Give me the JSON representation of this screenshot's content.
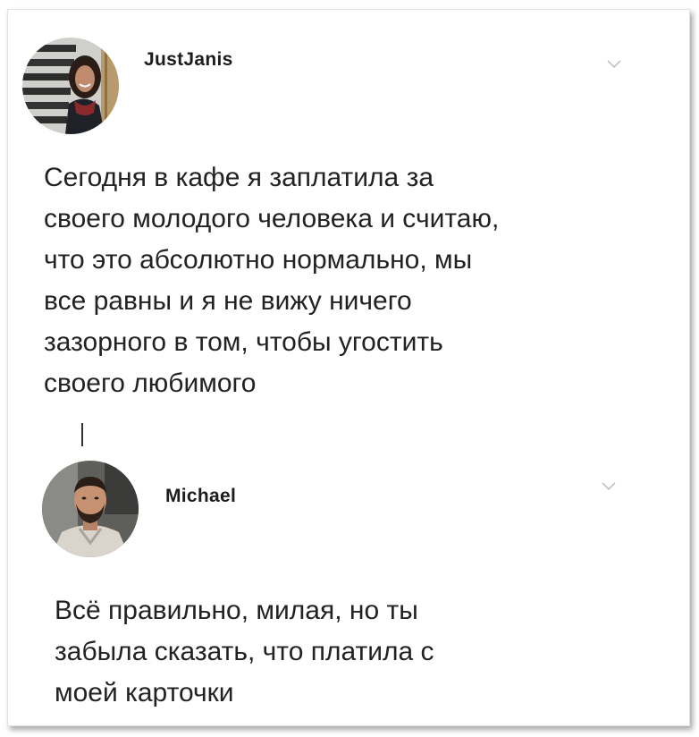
{
  "posts": [
    {
      "username": "JustJanis",
      "text": "Сегодня в кафе я заплатила за\nсвоего молодого человека и считаю,\nчто это абсолютно нормально, мы\nвсе равны и я не вижу ничего\nзазорного в том, чтобы угостить\nсвоего любимого",
      "avatar_icon": "woman-portrait-avatar",
      "menu_icon": "chevron-down-icon"
    },
    {
      "username": "Michael",
      "text": "Всё правильно, милая, но ты\nзабыла сказать, что платила с\nмоей карточки",
      "avatar_icon": "man-portrait-avatar",
      "menu_icon": "chevron-down-icon"
    }
  ],
  "colors": {
    "text": "#222222",
    "username": "#1c1c1c",
    "chevron": "#b8bcc2",
    "thread_line": "#333333"
  }
}
